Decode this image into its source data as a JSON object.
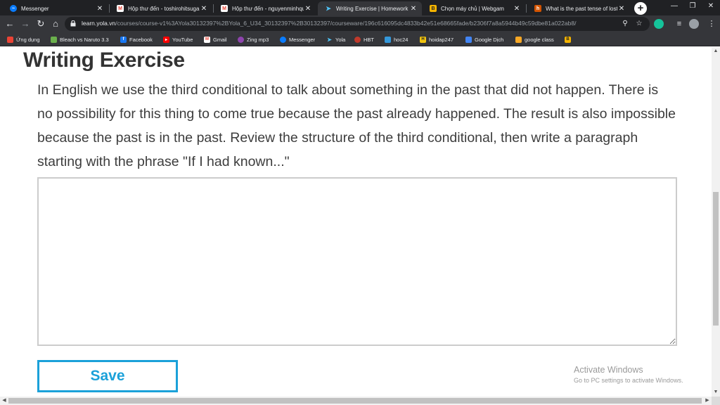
{
  "browser": {
    "tabs": [
      {
        "label": "Messenger",
        "icon": "messenger-icon",
        "color": "#0a7cff"
      },
      {
        "label": "Hộp thư đến - toshirohitsuga",
        "icon": "gmail-icon",
        "color": "#ea4335"
      },
      {
        "label": "Hộp thư đến - nguyenminhqu",
        "icon": "gmail-icon",
        "color": "#ea4335"
      },
      {
        "label": "Writing Exercise | Homework |",
        "icon": "yola-icon",
        "color": "#4fc3f7"
      },
      {
        "label": "Chọn máy chủ | Webgam",
        "icon": "b-icon",
        "color": "#f5b400"
      },
      {
        "label": "What is the past tense of lost",
        "icon": "h-icon",
        "color": "#d35400"
      }
    ],
    "new_tab": "+",
    "url_host": "learn.yola.vn",
    "url_path": "/courses/course-v1%3AYola30132397%2BYola_6_U34_30132397%2B30132397/courseware/196c616095dc4833b42e51e68665fade/b2306f7a8a5944b49c59dbe81a022ab8/",
    "bookmarks": [
      {
        "label": "Ứng dụng",
        "icon": "apps-icon",
        "color": "#ea4335"
      },
      {
        "label": "Bleach vs Naruto 3.3",
        "icon": "game-icon",
        "color": "#6ab04c"
      },
      {
        "label": "Facebook",
        "icon": "facebook-icon",
        "color": "#1877f2"
      },
      {
        "label": "YouTube",
        "icon": "youtube-icon",
        "color": "#ff0000"
      },
      {
        "label": "Gmail",
        "icon": "gmail-icon",
        "color": "#ea4335"
      },
      {
        "label": "Zing mp3",
        "icon": "zing-icon",
        "color": "#8e44ad"
      },
      {
        "label": "Messenger",
        "icon": "messenger-icon",
        "color": "#0a7cff"
      },
      {
        "label": "Yola",
        "icon": "yola-icon",
        "color": "#4fc3f7"
      },
      {
        "label": "HBT",
        "icon": "hbt-icon",
        "color": "#c0392b"
      },
      {
        "label": "hoc24",
        "icon": "cloud-icon",
        "color": "#3498db"
      },
      {
        "label": "hoidap247",
        "icon": "h-icon",
        "color": "#f1c40f"
      },
      {
        "label": "Google Dịch",
        "icon": "translate-icon",
        "color": "#4285f4"
      },
      {
        "label": "google class",
        "icon": "classroom-icon",
        "color": "#f9a825"
      },
      {
        "label": "",
        "icon": "b-icon",
        "color": "#f5b400"
      }
    ]
  },
  "page": {
    "title": "Writing Exercise",
    "prompt": "In English we use the third conditional to talk about something in the past that did not happen. There is no possibility for this thing to come true because the past already happened. The result is also impossible because the past is in the past. Review the structure of the third conditional, then write a paragraph starting with the phrase \"If I had known...\"",
    "answer_value": "",
    "save_label": "Save"
  },
  "watermark": {
    "line1": "Activate Windows",
    "line2": "Go to PC settings to activate Windows."
  }
}
